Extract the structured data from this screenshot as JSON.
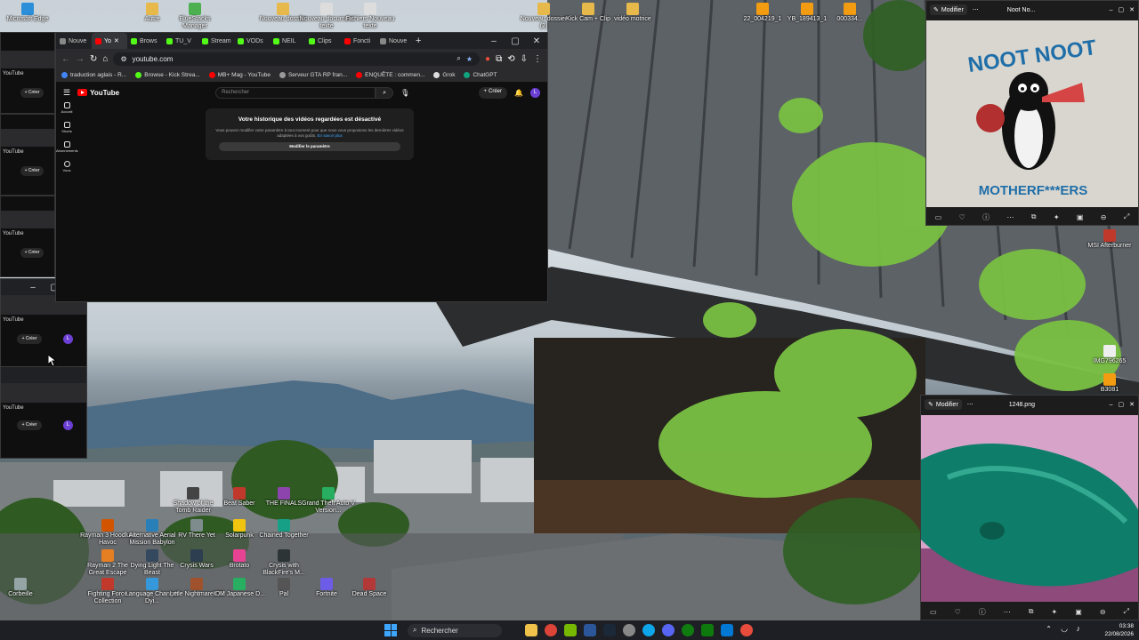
{
  "browser": {
    "tabs": [
      "Nouve",
      "Yo",
      "Brows",
      "TU_V",
      "Stream",
      "VODs",
      "NEIL",
      "Clips",
      "Foncti",
      "Nouve"
    ],
    "active_tab_index": 1,
    "url": "youtube.com",
    "bookmarks": [
      "traduction aglais - R...",
      "Browse - Kick Strea...",
      "MB+ Mag - YouTube",
      "Serveur GTA RP fran...",
      "ENQUÊTE : commen...",
      "Grok",
      "ChatGPT"
    ]
  },
  "youtube": {
    "logo": "YouTube",
    "search_placeholder": "Rechercher",
    "create_label": "Créer",
    "avatar_letter": "L",
    "sidebar": [
      "Accueil",
      "Shorts",
      "Abonnements",
      "Vous"
    ],
    "history_title": "Votre historique des vidéos regardées est désactivé",
    "history_text": "Vous pouvez modifier votre paramètre à tout moment pour que nous vous proposions les dernières vidéos adaptées à vos goûts.",
    "history_link": "En savoir plus",
    "history_button": "Modifier le paramètre"
  },
  "ghosts": {
    "youtube_label": "YouTube",
    "create_label": "Créer"
  },
  "media_top": {
    "modify_label": "Modifier",
    "title": "Noot No...",
    "poster_top": "NOOT NOOT",
    "poster_bottom": "MOTHERF***ERS"
  },
  "media_bottom": {
    "modify_label": "Modifier",
    "title": "1248.png"
  },
  "desktop_icons_top": [
    "Microsoft Edge",
    "Autre",
    "BlueStacks Manager",
    "Nouveau dossier",
    "Nouveau document texte",
    "Fichiers Nouveau texte",
    "Nouveau dossier (2)",
    "Kick Cam + Clip",
    "vidéo motrice",
    "22_004219_1",
    "YB_189413_1",
    "000334..."
  ],
  "desktop_icons_bottom": [
    "Shadow of the Tomb Raider",
    "Beat Saber",
    "THE FINALS",
    "Grand Theft Auto V Version...",
    "Rayman 3 Hoodlum Havoc",
    "Alternative Aerial Mission Babylon",
    "RV There Yet",
    "Chained Together",
    "Solarpunk",
    "Rayman 2 The Great Escape",
    "Dying Light The Beast",
    "Crysis Wars",
    "Brotato",
    "Crysis with BlackFire's M...",
    "Corbeille",
    "Fighting Force Collection",
    "Language Changer Dyi...",
    "Little Nightmares III",
    "IDM Japanese D...",
    "Pal",
    "Fortnite",
    "Dead Space"
  ],
  "desktop_icons_right": [
    "MSI Afterburner",
    "IMG796265",
    "B3081"
  ],
  "taskbar": {
    "search_label": "Rechercher",
    "time": "03:38",
    "date": "22/08/2026"
  }
}
